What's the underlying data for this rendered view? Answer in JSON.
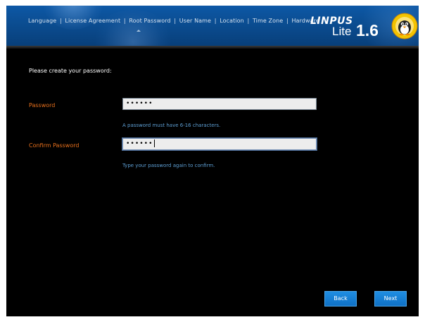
{
  "steps": [
    {
      "label": "Language"
    },
    {
      "label": "License Agreement"
    },
    {
      "label": "Root Password"
    },
    {
      "label": "User Name"
    },
    {
      "label": "Location"
    },
    {
      "label": "Time Zone"
    },
    {
      "label": "Hardware"
    }
  ],
  "step_separator": "|",
  "brand": {
    "name": "LINPUS",
    "edition": "Lite",
    "version": "1.6",
    "mascot_icon": "linpus-penguin-logo"
  },
  "form": {
    "prompt": "Please create your password:",
    "password": {
      "label": "Password",
      "value": "••••••",
      "hint": "A password must have 6-16 characters."
    },
    "confirm": {
      "label": "Confirm Password",
      "value": "••••••",
      "hint": "Type your password again to confirm."
    }
  },
  "buttons": {
    "back": "Back",
    "next": "Next"
  },
  "colors": {
    "header_blue": "#0b4e93",
    "label_orange": "#e8701c",
    "hint_blue": "#5e9fd4",
    "button_blue": "#1480d6"
  }
}
